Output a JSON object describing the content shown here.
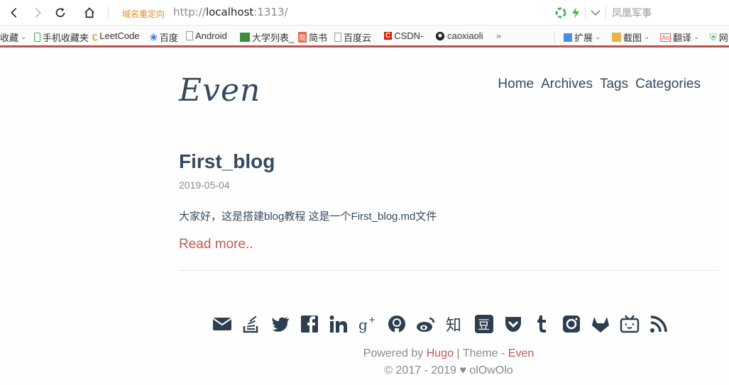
{
  "browser": {
    "redirect_label": "域名重定向",
    "url_prefix": "http://",
    "url_host": "localhost",
    "url_suffix": ":1313/",
    "search_placeholder": "凤凰军事"
  },
  "bookmarks": [
    {
      "label": "收藏",
      "icon": "star-icon"
    },
    {
      "label": "手机收藏夹",
      "icon": "phone-icon"
    },
    {
      "label": "LeetCode",
      "icon": "leetcode-icon"
    },
    {
      "label": "百度",
      "icon": "baidu-icon"
    },
    {
      "label": "Android",
      "icon": "page-icon"
    },
    {
      "label": "大学列表_",
      "icon": "book-icon"
    },
    {
      "label": "简书",
      "icon": "jianshu-icon"
    },
    {
      "label": "百度云",
      "icon": "page-icon"
    },
    {
      "label": "CSDN-",
      "icon": "csdn-icon"
    },
    {
      "label": "caoxiaoli",
      "icon": "github-icon"
    },
    {
      "label": "»",
      "icon": ""
    },
    {
      "label": "扩展",
      "icon": "extension-icon"
    },
    {
      "label": "截图",
      "icon": "screenshot-icon"
    },
    {
      "label": "翻译",
      "icon": "translate-icon"
    },
    {
      "label": "网",
      "icon": "shield-icon"
    }
  ],
  "site": {
    "logo": "Even",
    "menu": [
      "Home",
      "Archives",
      "Tags",
      "Categories"
    ]
  },
  "post": {
    "title": "First_blog",
    "date": "2019-05-04",
    "summary": "大家好，这是搭建blog教程 这是一个First_blog.md文件",
    "read_more": "Read more.."
  },
  "social_icons": [
    "email-icon",
    "stackoverflow-icon",
    "twitter-icon",
    "facebook-icon",
    "linkedin-icon",
    "google-plus-icon",
    "github-icon",
    "weibo-icon",
    "zhihu-icon",
    "douban-icon",
    "pocket-icon",
    "tumblr-icon",
    "instagram-icon",
    "gitlab-icon",
    "bilibili-icon",
    "rss-icon"
  ],
  "footer": {
    "powered_by": "Powered by",
    "hugo": "Hugo",
    "theme_sep": "| Theme -",
    "even": "Even",
    "copyright": "© 2017 - 2019",
    "author": "olOwOlo"
  },
  "colors": {
    "accent": "#c05b4d",
    "text": "#34495e",
    "muted": "#8a8a8a"
  }
}
